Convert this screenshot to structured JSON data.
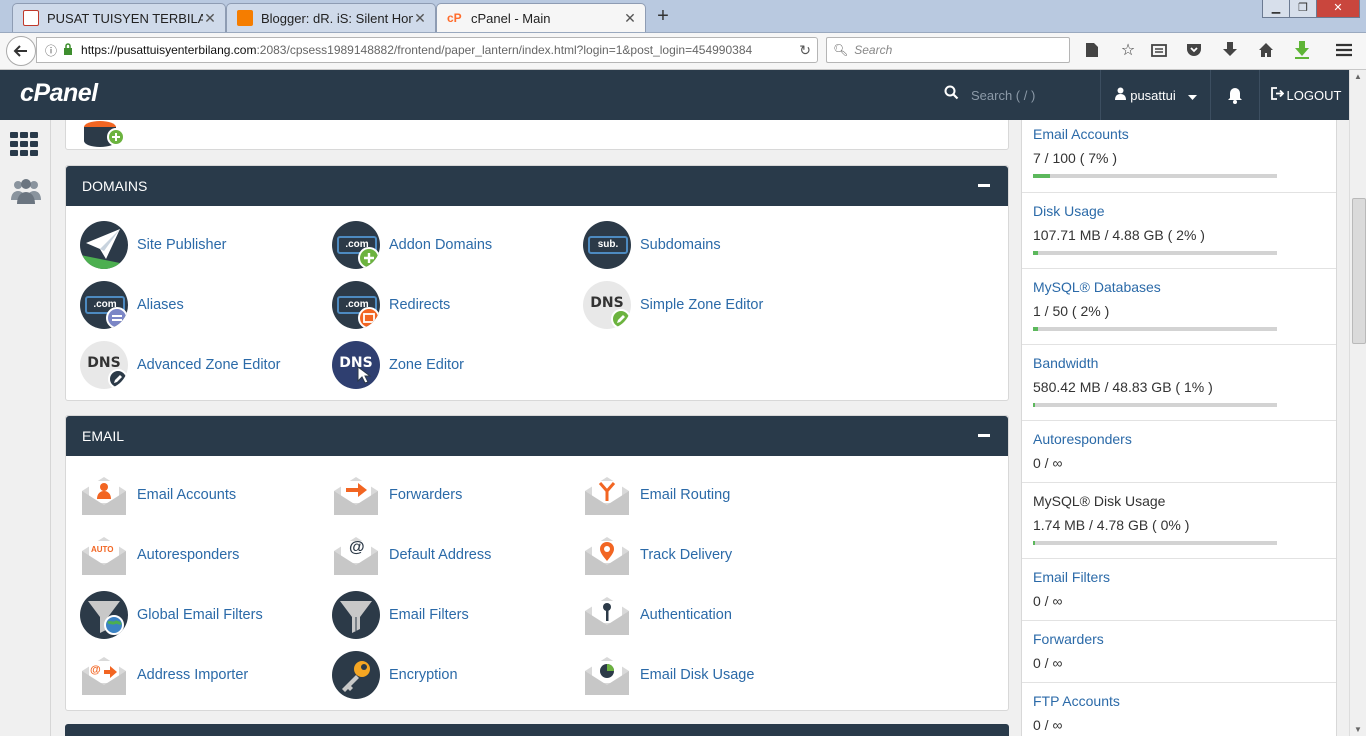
{
  "browser": {
    "tabs": [
      {
        "title": "PUSAT TUISYEN TERBILANG",
        "favicon_color": "#c0392b"
      },
      {
        "title": "Blogger: dR. iS: Silent Home",
        "favicon_color": "#f57d00"
      },
      {
        "title": "cPanel - Main",
        "favicon_color": "#ff6c2c"
      }
    ],
    "new_tab": "+",
    "url_host": "https://pusattuisyenterbilang.com",
    "url_rest": ":2083/cpsess1989148882/frontend/paper_lantern/index.html?login=1&post_login=454990384",
    "search_placeholder": "Search"
  },
  "header": {
    "logo": "cPanel",
    "search_placeholder": "Search ( / )",
    "username": "pusattui",
    "logout_label": "LOGOUT"
  },
  "sections": {
    "domains": {
      "title": "DOMAINS",
      "items": [
        {
          "label": "Site Publisher",
          "icon": "paper-plane-icon"
        },
        {
          "label": "Addon Domains",
          "icon": "addon-domains-icon"
        },
        {
          "label": "Subdomains",
          "icon": "subdomains-icon"
        },
        {
          "label": "Aliases",
          "icon": "aliases-icon"
        },
        {
          "label": "Redirects",
          "icon": "redirects-icon"
        },
        {
          "label": "Simple Zone Editor",
          "icon": "dns-pencil-icon"
        },
        {
          "label": "Advanced Zone Editor",
          "icon": "dns-pencil-icon"
        },
        {
          "label": "Zone Editor",
          "icon": "dns-cursor-icon"
        }
      ],
      "icon_text": {
        "com": ".com",
        "sub": "sub.",
        "dns": "DNS"
      }
    },
    "email": {
      "title": "EMAIL",
      "items": [
        {
          "label": "Email Accounts",
          "icon": "email-accounts-icon"
        },
        {
          "label": "Forwarders",
          "icon": "forwarders-icon"
        },
        {
          "label": "Email Routing",
          "icon": "email-routing-icon"
        },
        {
          "label": "Autoresponders",
          "icon": "autoresponders-icon"
        },
        {
          "label": "Default Address",
          "icon": "default-address-icon"
        },
        {
          "label": "Track Delivery",
          "icon": "track-delivery-icon"
        },
        {
          "label": "Global Email Filters",
          "icon": "global-filter-icon"
        },
        {
          "label": "Email Filters",
          "icon": "funnel-icon"
        },
        {
          "label": "Authentication",
          "icon": "key-icon"
        },
        {
          "label": "Address Importer",
          "icon": "address-importer-icon"
        },
        {
          "label": "Encryption",
          "icon": "encryption-key-icon"
        },
        {
          "label": "Email Disk Usage",
          "icon": "pie-envelope-icon"
        }
      ],
      "icon_text": {
        "auto": "AUTO",
        "at": "@"
      }
    }
  },
  "stats": [
    {
      "name": "Email Accounts",
      "value": "7 / 100 ( 7% )",
      "percent": 7,
      "link": true
    },
    {
      "name": "Disk Usage",
      "value": "107.71 MB / 4.88 GB ( 2% )",
      "percent": 2,
      "link": true
    },
    {
      "name": "MySQL® Databases",
      "value": "1 / 50 ( 2% )",
      "percent": 2,
      "link": true
    },
    {
      "name": "Bandwidth",
      "value": "580.42 MB / 48.83 GB ( 1% )",
      "percent": 1,
      "link": true
    },
    {
      "name": "Autoresponders",
      "value": "0 / ∞",
      "link": true
    },
    {
      "name": "MySQL® Disk Usage",
      "value": "1.74 MB / 4.78 GB ( 0% )",
      "percent": 0,
      "link": false
    },
    {
      "name": "Email Filters",
      "value": "0 / ∞",
      "link": true
    },
    {
      "name": "Forwarders",
      "value": "0 / ∞",
      "link": true
    },
    {
      "name": "FTP Accounts",
      "value": "0 / ∞",
      "link": true
    }
  ],
  "colors": {
    "header_bg": "#293a4a",
    "link": "#2b6aa8",
    "progress": "#5cb85c",
    "accent_orange": "#f26522",
    "accent_green": "#6cb33f"
  }
}
